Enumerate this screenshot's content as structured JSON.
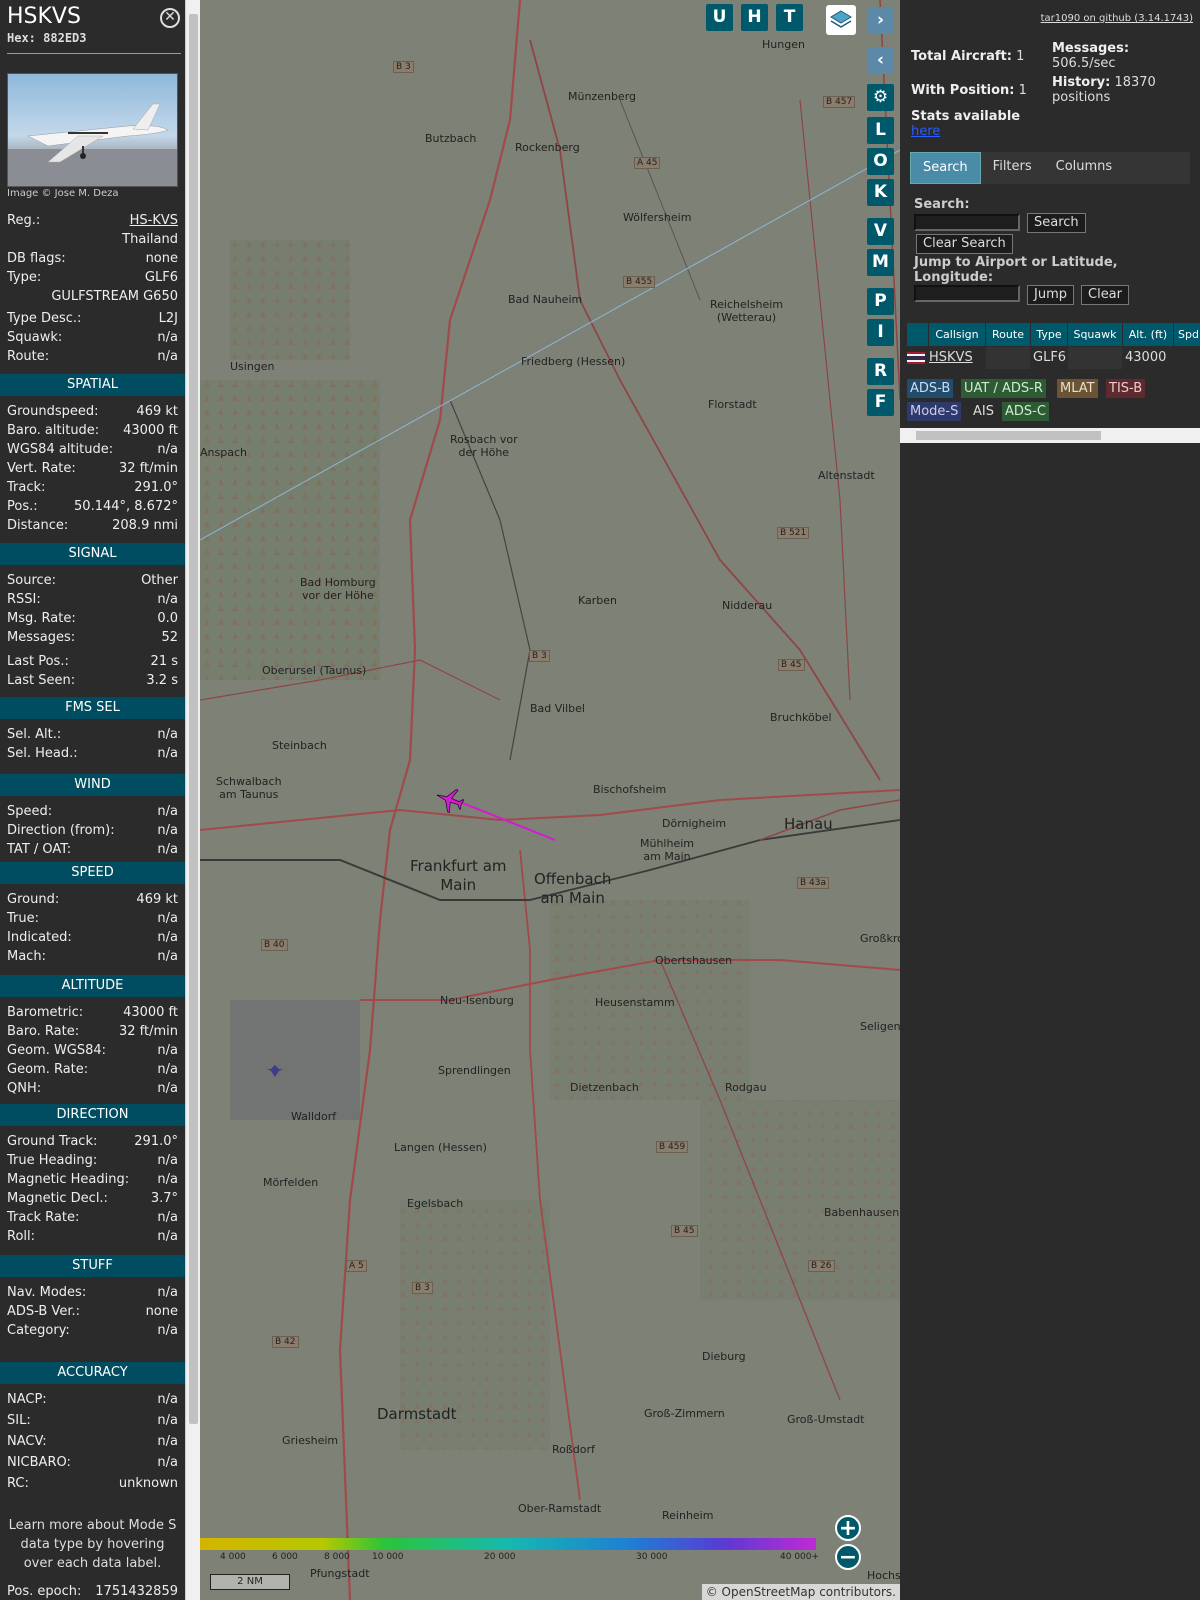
{
  "aircraft": {
    "title": "HSKVS",
    "hex_label": "Hex:",
    "hex": "882ED3",
    "photo_credit": "Image © Jose M. Deza",
    "reg_label": "Reg.:",
    "reg": "HS-KVS",
    "country": "Thailand",
    "dbflags_label": "DB flags:",
    "dbflags": "none",
    "type_label": "Type:",
    "type": "GLF6",
    "type_full": "GULFSTREAM G650",
    "typedesc_label": "Type Desc.:",
    "typedesc": "L2J",
    "squawk_label": "Squawk:",
    "squawk": "n/a",
    "route_label": "Route:",
    "route": "n/a"
  },
  "sections": {
    "spatial": "SPATIAL",
    "signal": "SIGNAL",
    "fms": "FMS SEL",
    "wind": "WIND",
    "speed": "SPEED",
    "altitude": "ALTITUDE",
    "direction": "DIRECTION",
    "stuff": "STUFF",
    "accuracy": "ACCURACY"
  },
  "spatial": [
    {
      "k": "Groundspeed:",
      "v": "469 kt"
    },
    {
      "k": "Baro. altitude:",
      "v": "43000 ft"
    },
    {
      "k": "WGS84 altitude:",
      "v": "n/a"
    },
    {
      "k": "Vert. Rate:",
      "v": "32 ft/min"
    },
    {
      "k": "Track:",
      "v": "291.0°"
    },
    {
      "k": "Pos.:",
      "v": "50.144°, 8.672°"
    },
    {
      "k": "Distance:",
      "v": "208.9 nmi"
    }
  ],
  "signal": [
    {
      "k": "Source:",
      "v": "Other"
    },
    {
      "k": "RSSI:",
      "v": "n/a"
    },
    {
      "k": "Msg. Rate:",
      "v": "0.0"
    },
    {
      "k": "Messages:",
      "v": "52"
    },
    {
      "k": "Last Pos.:",
      "v": "21 s"
    },
    {
      "k": "Last Seen:",
      "v": "3.2 s"
    }
  ],
  "fms": [
    {
      "k": "Sel. Alt.:",
      "v": "n/a"
    },
    {
      "k": "Sel. Head.:",
      "v": "n/a"
    }
  ],
  "wind": [
    {
      "k": "Speed:",
      "v": "n/a"
    },
    {
      "k": "Direction (from):",
      "v": "n/a"
    },
    {
      "k": "TAT / OAT:",
      "v": "n/a"
    }
  ],
  "speed": [
    {
      "k": "Ground:",
      "v": "469 kt"
    },
    {
      "k": "True:",
      "v": "n/a"
    },
    {
      "k": "Indicated:",
      "v": "n/a"
    },
    {
      "k": "Mach:",
      "v": "n/a"
    }
  ],
  "altitude": [
    {
      "k": "Barometric:",
      "v": "43000 ft"
    },
    {
      "k": "Baro. Rate:",
      "v": "32 ft/min"
    },
    {
      "k": "Geom. WGS84:",
      "v": "n/a"
    },
    {
      "k": "Geom. Rate:",
      "v": "n/a"
    },
    {
      "k": "QNH:",
      "v": "n/a"
    }
  ],
  "direction": [
    {
      "k": "Ground Track:",
      "v": "291.0°"
    },
    {
      "k": "True Heading:",
      "v": "n/a"
    },
    {
      "k": "Magnetic Heading:",
      "v": "n/a"
    },
    {
      "k": "Magnetic Decl.:",
      "v": "3.7°"
    },
    {
      "k": "Track Rate:",
      "v": "n/a"
    },
    {
      "k": "Roll:",
      "v": "n/a"
    }
  ],
  "stuff": [
    {
      "k": "Nav. Modes:",
      "v": "n/a"
    },
    {
      "k": "ADS-B Ver.:",
      "v": "none"
    },
    {
      "k": "Category:",
      "v": "n/a"
    }
  ],
  "accuracy": [
    {
      "k": "NACP:",
      "v": "n/a"
    },
    {
      "k": "SIL:",
      "v": "n/a"
    },
    {
      "k": "NACV:",
      "v": "n/a"
    },
    {
      "k": "NICBARO:",
      "v": "n/a"
    },
    {
      "k": "RC:",
      "v": "unknown"
    }
  ],
  "learn_more": "Learn more about Mode S data type by hovering over each data label.",
  "pos_epoch_label": "Pos. epoch:",
  "pos_epoch": "1751432859",
  "map": {
    "tool_buttons": [
      "U",
      "H",
      "T"
    ],
    "side_buttons": [
      "L",
      "O",
      "K",
      "V",
      "M",
      "P",
      "I",
      "R",
      "F"
    ],
    "scale": "2 NM",
    "attribution": "© OpenStreetMap contributors.",
    "legend_labels": [
      "4 000",
      "6 000",
      "8 000",
      "10 000",
      "20 000",
      "30 000",
      "40 000+"
    ],
    "places": [
      "Hungen",
      "Münzenberg",
      "Butzbach",
      "Rockenberg",
      "Wölfersheim",
      "Bad Nauheim",
      "Reichelsheim (Wetterau)",
      "Usingen",
      "Friedberg (Hessen)",
      "Florstadt",
      "Rosbach vor der Höhe",
      "Anspach",
      "Altenstadt",
      "Bad Homburg vor der Höhe",
      "Karben",
      "Nidderau",
      "Oberursel (Taunus)",
      "Bad Vilbel",
      "Bruchköbel",
      "Steinbach",
      "Schwalbach am Taunus",
      "Bischofsheim",
      "Dörnigheim",
      "Hanau",
      "Mühlheim am Main",
      "Frankfurt am Main",
      "Offenbach am Main",
      "Obertshausen",
      "Neu-Isenburg",
      "Heusenstamm",
      "Sprendlingen",
      "Dietzenbach",
      "Rodgau",
      "Walldorf",
      "Langen (Hessen)",
      "Mörfelden",
      "Egelsbach",
      "Babenhausen",
      "Dieburg",
      "Darmstadt",
      "Groß-Zimmern",
      "Groß-Umstadt",
      "Griesheim",
      "Roßdorf",
      "Ober-Ramstadt",
      "Reinheim",
      "Pfungstadt",
      "Seligen",
      "Großkro",
      "Hochst"
    ]
  },
  "right": {
    "github": "tar1090 on github (3.14.1743)",
    "total_aircraft_label": "Total Aircraft:",
    "total_aircraft": "1",
    "messages_label": "Messages:",
    "messages": "506.5/sec",
    "with_position_label": "With Position:",
    "with_position": "1",
    "history_label": "History:",
    "history": "18370 positions",
    "stats_label": "Stats available",
    "stats_link": "here",
    "tabs": [
      "Search",
      "Filters",
      "Columns"
    ],
    "search_label": "Search:",
    "search_button": "Search",
    "clear_search_button": "Clear Search",
    "jump_label": "Jump to Airport or Latitude, Longitude:",
    "jump_button": "Jump",
    "clear_button": "Clear",
    "columns": [
      "Callsign",
      "Route",
      "Type",
      "Squawk",
      "Alt. (ft)",
      "Spd."
    ],
    "row": {
      "callsign": "HSKVS",
      "route": "",
      "type": "GLF6",
      "squawk": "",
      "alt": "43000"
    },
    "sources": [
      "ADS-B",
      "UAT / ADS-R",
      "MLAT",
      "TIS-B",
      "Mode-S",
      "AIS",
      "ADS-C"
    ]
  },
  "colors": {
    "header_teal": "#00596b",
    "track": "#d21bd2",
    "panel": "#2b2b2b"
  }
}
